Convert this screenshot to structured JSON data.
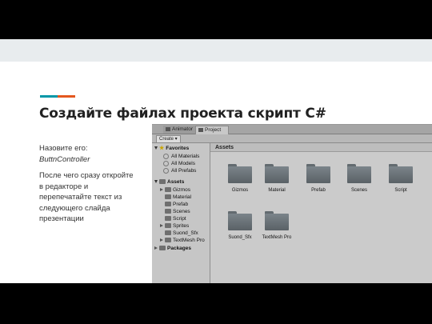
{
  "colors": {
    "accent_teal": "#0097a7",
    "accent_orange": "#e4571e",
    "star": "#c9a400"
  },
  "slide": {
    "title": "Создайте файлах проекта скрипт C#",
    "text1_line1": "Назовите его:",
    "text1_line2": "ButtnController",
    "text2": "После чего сразу откройте в редакторе и перепечатайте текст из следующего слайда презентации"
  },
  "unity": {
    "tabs": [
      {
        "label": "Animator",
        "icon": "animator-icon"
      },
      {
        "label": "Project",
        "icon": "project-icon"
      }
    ],
    "create_label": "Create ▾",
    "tree": {
      "favorites": "Favorites",
      "favorite_items": [
        "All Materials",
        "All Models",
        "All Prefabs"
      ],
      "assets": "Assets",
      "asset_items": [
        "Gizmos",
        "Material",
        "Prefab",
        "Scenes",
        "Script",
        "Sprites",
        "Suond_Sfx",
        "TextMesh Pro"
      ],
      "packages": "Packages"
    },
    "panel_title": "Assets",
    "folders": [
      "Gizmos",
      "Material",
      "Prefab",
      "Scenes",
      "Script",
      "Suond_Sfx",
      "TextMesh Pro"
    ]
  }
}
